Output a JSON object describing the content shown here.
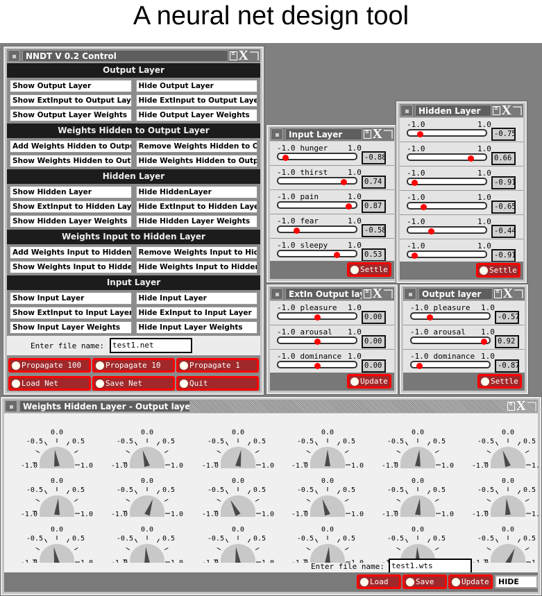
{
  "page_title": "A neural net design tool",
  "colors": {
    "desktop": "#808080",
    "title_bar": "#5e5e5e",
    "section_header": "#1c1c1c",
    "slider_knob": "#ff0000",
    "action_button": "#a0282a",
    "action_border": "#ff0000",
    "gauge_face": "#c8c8c8",
    "gauge_needle": "#4a4a4a"
  },
  "icons": {
    "window_menu": "window-menu-icon",
    "document": "document-icon",
    "close": "close-x-icon",
    "maximize": "maximize-icon",
    "radio": "radio-dot-icon"
  },
  "control": {
    "title": "NNDT V 0.2 Control",
    "sections": [
      {
        "header": "Output Layer",
        "buttons": [
          [
            "Show Output Layer",
            "Hide Output Layer"
          ],
          [
            "Show ExtInput to Output Layer",
            "Hide ExtInput to Output Layer"
          ],
          [
            "Show Output Layer Weights",
            "Hide Output Layer Weights"
          ]
        ]
      },
      {
        "header": "Weights Hidden to Output Layer",
        "buttons": [
          [
            "Add Weights Hidden to Output",
            "Remove Weights Hidden to Output"
          ],
          [
            "Show Weights Hidden to Output",
            "Hide Weights Hidden to Output"
          ]
        ]
      },
      {
        "header": "Hidden Layer",
        "buttons": [
          [
            "Show Hidden Layer",
            "Hide HiddenLayer"
          ],
          [
            "Show ExtInput to Hidden Layer",
            "Hide ExtInput to Hidden Layer"
          ],
          [
            "Show Hidden Layer Weights",
            "Hide Hidden Layer Weights"
          ]
        ]
      },
      {
        "header": "Weights Input to Hidden Layer",
        "buttons": [
          [
            "Add Weights Input to Hidden",
            "Remove Weights Input to Hidden"
          ],
          [
            "Show Weights Input to Hidden",
            "Hide Weights Input to Hidden"
          ]
        ]
      },
      {
        "header": "Input Layer",
        "buttons": [
          [
            "Show Input Layer",
            "Hide Input Layer"
          ],
          [
            "Show ExtInput to Input Layer",
            "Hide ExInput to Input Layer"
          ],
          [
            "Show Input Layer Weights",
            "Hide Input Layer Weights"
          ]
        ]
      }
    ],
    "file_label": "Enter file name:",
    "file_value": "test1.net",
    "actions": [
      "Propagate 100",
      "Propagate 10",
      "Propagate 1",
      "Load Net",
      "Save Net",
      "Quit"
    ]
  },
  "input_layer": {
    "title": "Input Layer",
    "min_label": "-1.0",
    "max_label": "1.0",
    "button": "Settle",
    "units": [
      {
        "name": "hunger",
        "value": -0.88,
        "display": "-0.88"
      },
      {
        "name": "thirst",
        "value": 0.74,
        "display": "0.74"
      },
      {
        "name": "pain",
        "value": 0.87,
        "display": "0.87"
      },
      {
        "name": "fear",
        "value": -0.58,
        "display": "-0.58"
      },
      {
        "name": "sleepy",
        "value": 0.53,
        "display": "0.53"
      }
    ]
  },
  "hidden_layer": {
    "title": "Hidden Layer",
    "min_label": "-1.0",
    "max_label": "1.0",
    "button": "Settle",
    "units": [
      {
        "name": "",
        "value": -0.75,
        "display": "-0.75"
      },
      {
        "name": "",
        "value": 0.66,
        "display": "0.66"
      },
      {
        "name": "",
        "value": -0.91,
        "display": "-0.91"
      },
      {
        "name": "",
        "value": -0.65,
        "display": "-0.65"
      },
      {
        "name": "",
        "value": -0.44,
        "display": "-0.44"
      },
      {
        "name": "",
        "value": -0.91,
        "display": "-0.91"
      }
    ]
  },
  "extin_output": {
    "title": "ExtIn Output lay",
    "min_label": "-1.0",
    "max_label": "1.0",
    "button": "Update",
    "units": [
      {
        "name": "pleasure",
        "value": 0.0,
        "display": "0.00"
      },
      {
        "name": "arousal",
        "value": 0.0,
        "display": "0.00"
      },
      {
        "name": "dominance",
        "value": 0.0,
        "display": "0.00"
      }
    ]
  },
  "output_layer": {
    "title": "Output layer",
    "min_label": "-1.0",
    "max_label": "1.0",
    "button": "Settle",
    "units": [
      {
        "name": "pleasure",
        "value": -0.57,
        "display": "-0.57"
      },
      {
        "name": "arousal",
        "value": 0.92,
        "display": "0.92"
      },
      {
        "name": "dominance",
        "value": -0.87,
        "display": "-0.87"
      }
    ]
  },
  "weights": {
    "title": "Weights Hidden Layer -  Output layer",
    "tick_labels": {
      "top": "0.0",
      "left_mid": "-0.5",
      "right_mid": "0.5",
      "left": "-1.0",
      "right": "1.0"
    },
    "gauges": [
      -0.08,
      -0.17,
      0.12,
      0.0,
      0.06,
      -0.2,
      0.05,
      0.22,
      -0.3,
      -0.2,
      0.08,
      -0.06,
      -0.12,
      -0.05,
      -0.08,
      0.05,
      -0.02,
      0.27
    ],
    "file_label": "Enter file name:",
    "file_value": "test1.wts",
    "buttons": [
      "Load",
      "Save",
      "Update"
    ],
    "hide": "HIDE"
  }
}
